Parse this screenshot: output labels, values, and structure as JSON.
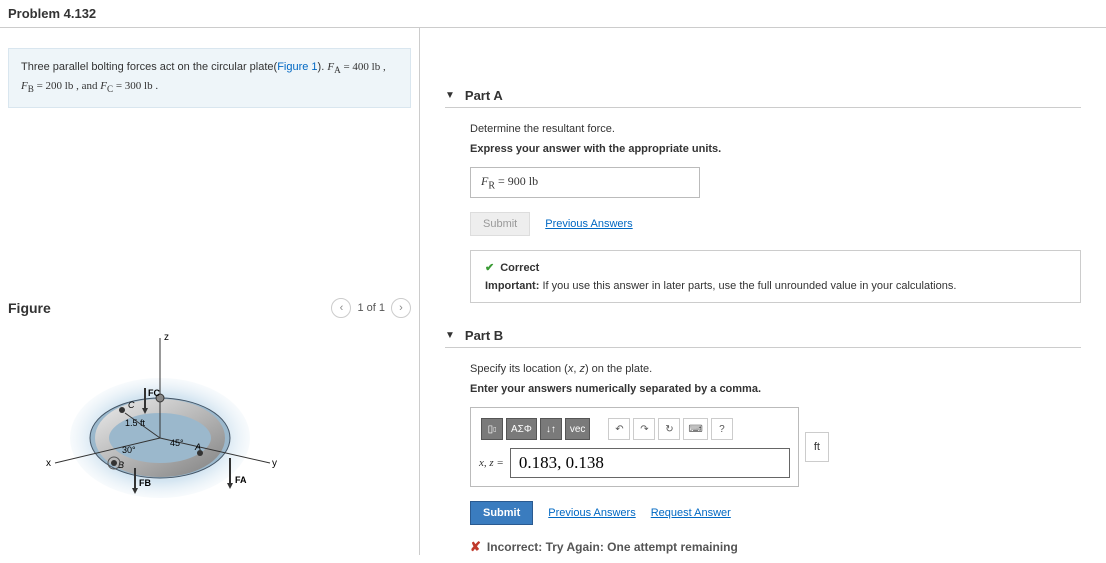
{
  "header": {
    "title": "Problem 4.132"
  },
  "problem": {
    "desc_pre": "Three parallel bolting forces act on the circular plate(",
    "figure_link": "Figure 1",
    "desc_post1": "). ",
    "fa_label": "F",
    "fa_sub": "A",
    "fa_text": " = 400 lb ,",
    "fb_label": "F",
    "fb_sub": "B",
    "fb_text": " = 200 lb , and ",
    "fc_label": "F",
    "fc_sub": "C",
    "fc_text": " = 300 lb .",
    "figure_title": "Figure",
    "pager": "1 of 1",
    "pager_prev": "‹",
    "pager_next": "›"
  },
  "figure": {
    "z_label": "z",
    "y_label": "y",
    "x_label": "x",
    "radius": "1.5 ft",
    "ang30": "30°",
    "ang45": "45°",
    "A": "A",
    "B": "B",
    "C": "C",
    "FA": "FA",
    "FB": "FB",
    "FC": "FC"
  },
  "partA": {
    "title": "Part A",
    "instr": "Determine the resultant force.",
    "instr_bold": "Express your answer with the appropriate units.",
    "ans_var": "F",
    "ans_sub": "R",
    "ans_text": " =  900 lb",
    "submit": "Submit",
    "prev_answers": "Previous Answers",
    "correct": "Correct",
    "important_label": "Important:",
    "important_text": " If you use this answer in later parts, use the full unrounded value in your calculations."
  },
  "partB": {
    "title": "Part B",
    "instr": "Specify its location (x, z) on the plate.",
    "instr_bold": "Enter your answers numerically separated by a comma.",
    "toolbar": {
      "t2": "ΑΣΦ",
      "t3": "↓↑",
      "t4": "vec",
      "undo": "↶",
      "redo": "↷",
      "reset": "↻",
      "kbd": "⌨",
      "help": "?"
    },
    "input_label": "x, z =",
    "input_value": "0.183, 0.138",
    "unit": "ft",
    "submit": "Submit",
    "prev_answers": "Previous Answers",
    "request_answer": "Request Answer",
    "incorrect": "Incorrect: Try Again: One attempt remaining"
  }
}
